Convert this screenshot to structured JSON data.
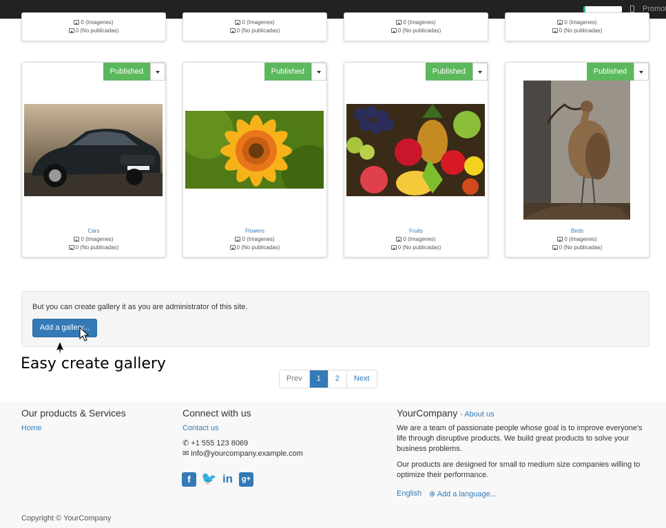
{
  "topbar": {
    "promote": "Promot"
  },
  "top_cards": [
    {
      "images": "0 (Imagenes)",
      "unpublished": "0 (No publicadas)"
    },
    {
      "images": "0 (Imagenes)",
      "unpublished": "0 (No publicadas)"
    },
    {
      "images": "0 (Imagenes)",
      "unpublished": "0 (No publicadas)"
    },
    {
      "images": "0 (Imagenes)",
      "unpublished": "0 (No publicadas)"
    }
  ],
  "galleries": [
    {
      "status": "Published",
      "name": "Cars",
      "images": "0 (Imagenes)",
      "unpublished": "0 (No publicadas)"
    },
    {
      "status": "Published",
      "name": "Flowers",
      "images": "0 (Imagenes)",
      "unpublished": "0 (No publicadas)"
    },
    {
      "status": "Published",
      "name": "Fruits",
      "images": "0 (Imagenes)",
      "unpublished": "0 (No publicadas)"
    },
    {
      "status": "Published",
      "name": "Birds",
      "images": "0 (Imagenes)",
      "unpublished": "0 (No publicadas)"
    }
  ],
  "admin_panel": {
    "message": "But you can create gallery it as you are administrator of this site.",
    "add_button": "Add a gallery..."
  },
  "caption": "Easy create gallery",
  "pager": {
    "prev": "Prev",
    "pages": [
      "1",
      "2"
    ],
    "next": "Next",
    "active_page": "1"
  },
  "footer": {
    "products_title": "Our products & Services",
    "home_link": "Home",
    "connect_title": "Connect with us",
    "contact_link": "Contact us",
    "phone": "+1 555 123 8069",
    "email": "info@yourcompany.example.com",
    "social_icons": [
      "facebook-icon",
      "twitter-icon",
      "linkedin-icon",
      "google-plus-icon"
    ],
    "company_name": "YourCompany",
    "about_link": "- About us",
    "about_text_1": "We are a team of passionate people whose goal is to improve everyone's life through disruptive products. We build great products to solve your business problems.",
    "about_text_2": "Our products are designed for small to medium size companies willing to optimize their performance.",
    "language": "English",
    "add_language": "Add a language...",
    "copyright": "Copyright © YourCompany"
  },
  "colors": {
    "published": "#5cb85c",
    "primary": "#337ab7",
    "topbar": "#222222"
  }
}
